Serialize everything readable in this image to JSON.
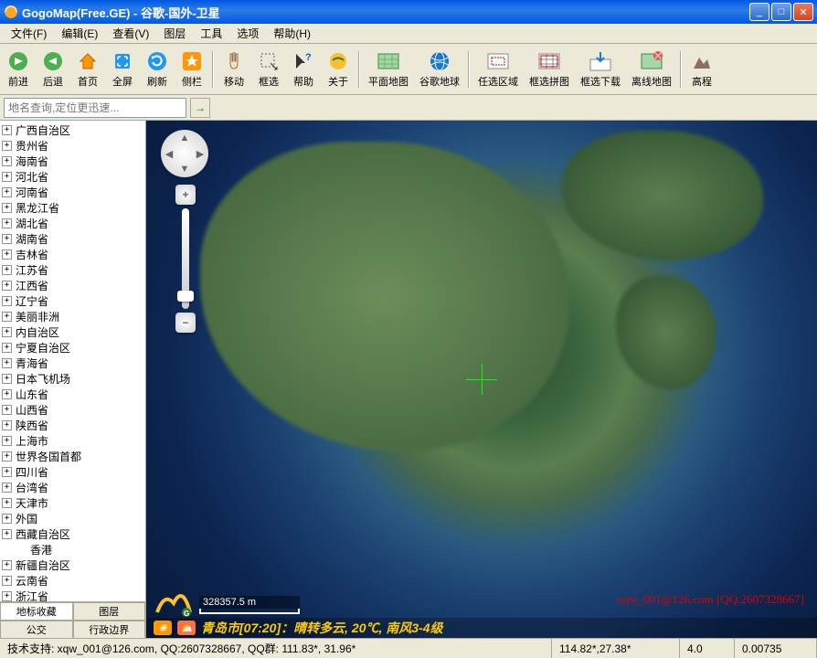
{
  "window": {
    "title": "GogoMap(Free.GE) - 谷歌-国外-卫星"
  },
  "menu": {
    "file": "文件(F)",
    "edit": "编辑(E)",
    "view": "查看(V)",
    "layers": "图层",
    "tools": "工具",
    "options": "选项",
    "help": "帮助(H)"
  },
  "toolbar": {
    "forward": "前进",
    "back": "后退",
    "home": "首页",
    "fullscreen": "全屏",
    "refresh": "刷新",
    "sidebar": "侧栏",
    "move": "移动",
    "box_select": "框选",
    "help": "帮助",
    "about": "关于",
    "flat_map": "平面地图",
    "google_earth": "谷歌地球",
    "select_area": "任选区域",
    "box_tile": "框选拼图",
    "box_download": "框选下载",
    "offline_map": "离线地图",
    "elevation": "高程"
  },
  "search": {
    "placeholder": "地名查询,定位更迅速...",
    "go": "→"
  },
  "tree": {
    "items": [
      "广西自治区",
      "贵州省",
      "海南省",
      "河北省",
      "河南省",
      "黑龙江省",
      "湖北省",
      "湖南省",
      "吉林省",
      "江苏省",
      "江西省",
      "辽宁省",
      "美丽非洲",
      "内自治区",
      "宁夏自治区",
      "青海省",
      "日本飞机场",
      "山东省",
      "山西省",
      "陕西省",
      "上海市",
      "世界各国首都",
      "四川省",
      "台湾省",
      "天津市",
      "外国",
      "西藏自治区",
      "香港",
      "新疆自治区",
      "云南省",
      "浙江省"
    ]
  },
  "sidebar_tabs": {
    "landmarks": "地标收藏",
    "layers": "图层",
    "transit": "公交",
    "admin": "行政边界"
  },
  "map": {
    "scale": "328357.5 m",
    "watermark": "xqw_001@126.com [QQ:2607328667]",
    "weather": "青岛市[07:20]：晴转多云, 20℃, 南风3-4级"
  },
  "statusbar": {
    "support": "技术支持: xqw_001@126.com, QQ:2607328667, QQ群: 111.83*, 31.96*",
    "coords": "114.82*,27.38*",
    "zoom": "4.0",
    "value": "0.00735"
  }
}
